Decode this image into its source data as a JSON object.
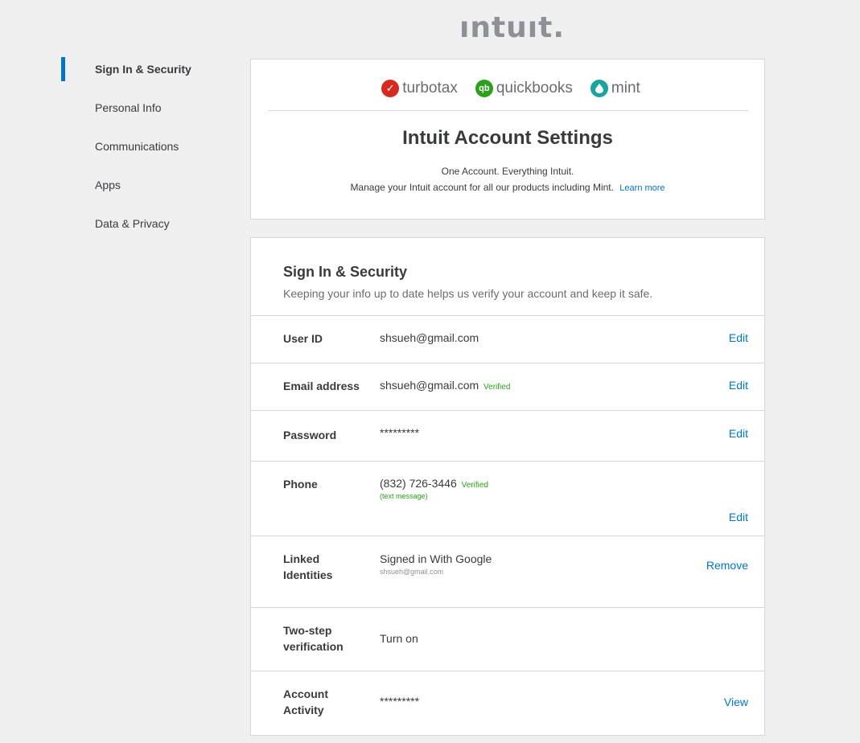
{
  "brand": {
    "logo_text": "ıntuıt",
    "logo_dot": "."
  },
  "sidebar": {
    "items": [
      {
        "label": "Sign In & Security",
        "active": true
      },
      {
        "label": "Personal Info"
      },
      {
        "label": "Communications"
      },
      {
        "label": "Apps"
      },
      {
        "label": "Data & Privacy"
      }
    ]
  },
  "products": [
    {
      "name": "turbotax",
      "icon": "check-mark-icon",
      "glyph": "✓",
      "color": "#d52b1e"
    },
    {
      "name": "quickbooks",
      "icon": "qb-icon",
      "glyph": "qb",
      "color": "#2ca01c"
    },
    {
      "name": "mint",
      "icon": "leaf-icon",
      "glyph": "💧",
      "color": "#1aa4a0"
    }
  ],
  "header": {
    "title": "Intuit Account Settings",
    "tagline": "One Account. Everything Intuit.",
    "description": "Manage your Intuit account for all our products including Mint.",
    "learn_more": "Learn more"
  },
  "security": {
    "title": "Sign In & Security",
    "subtitle": "Keeping your info up to date helps us verify your account and keep it safe.",
    "user_id": {
      "label": "User ID",
      "value": "shsueh@gmail.com",
      "action": "Edit"
    },
    "email": {
      "label": "Email address",
      "value": "shsueh@gmail.com",
      "status": "Verified",
      "action": "Edit"
    },
    "password": {
      "label": "Password",
      "value": "*********",
      "action": "Edit"
    },
    "phone": {
      "label": "Phone",
      "value": "(832) 726-3446",
      "status": "Verified",
      "note": "(text message)",
      "action": "Edit"
    },
    "linked": {
      "label_1": "Linked",
      "label_2": "Identities",
      "value": "Signed in With Google",
      "sub": "shsueh@gmail.com",
      "action": "Remove"
    },
    "two_step": {
      "label_1": "Two-step",
      "label_2": "verification",
      "action": "Turn on"
    },
    "activity": {
      "label_1": "Account",
      "label_2": "Activity",
      "value": "*********",
      "action": "View"
    }
  },
  "colors": {
    "accent": "#0077c5",
    "verified": "#2ca01c",
    "background": "#efeff0"
  }
}
